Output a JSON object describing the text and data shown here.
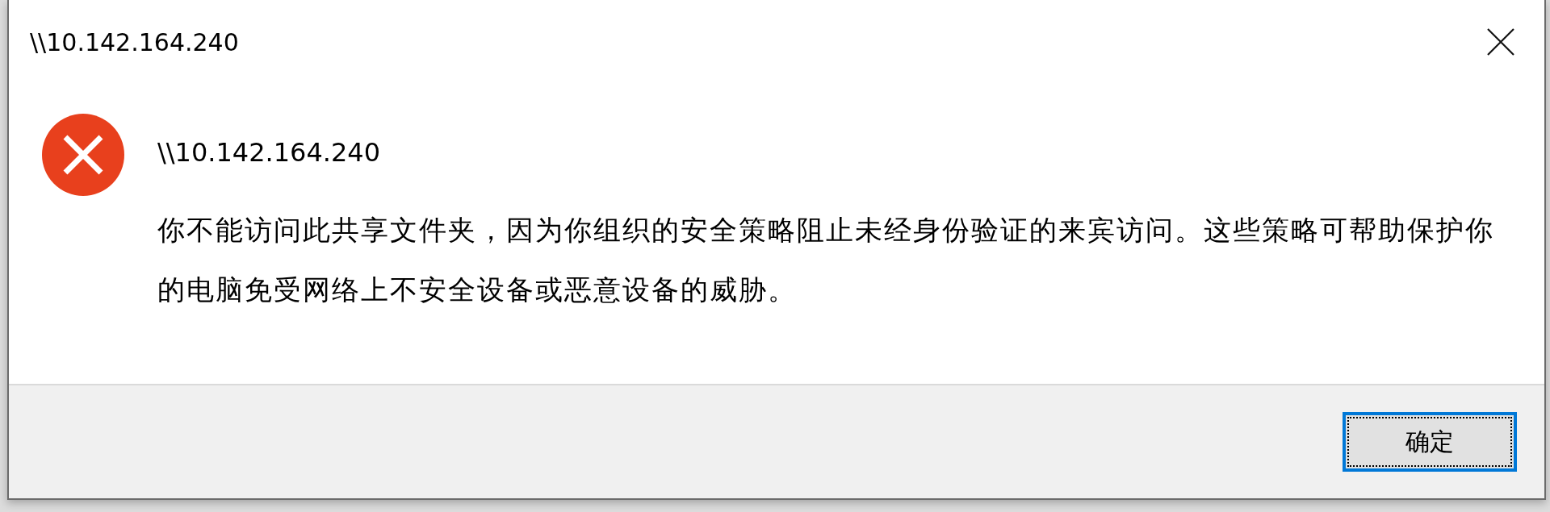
{
  "window": {
    "title": "\\\\10.142.164.240"
  },
  "message": {
    "kind": "error",
    "heading": "\\\\10.142.164.240",
    "text": "你不能访问此共享文件夹，因为你组织的安全策略阻止未经身份验证的来宾访问。这些策略可帮助保护你的电脑免受网络上不安全设备或恶意设备的威胁。"
  },
  "buttons": [
    {
      "label": "确定",
      "focused": true
    }
  ]
}
